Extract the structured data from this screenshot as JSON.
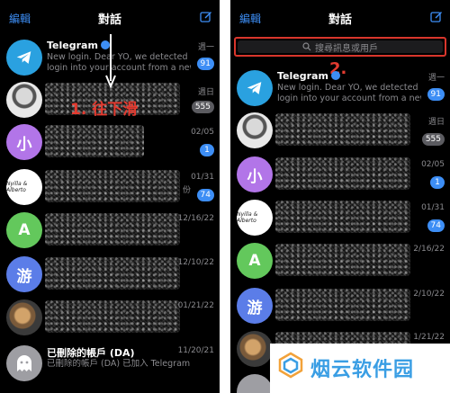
{
  "left": {
    "edit_label": "編輯",
    "title": "對話",
    "chats": [
      {
        "name": "Telegram",
        "preview": [
          "New login. Dear YO, we detected a",
          "login into your account from a new d"
        ],
        "date": "週一",
        "badge": "91"
      },
      {
        "name": "",
        "preview": [],
        "date": "週日",
        "badge": "555"
      },
      {
        "name": "",
        "preview": [],
        "date": "02/05",
        "badge": "1"
      },
      {
        "name": "",
        "preview": [
          "份"
        ],
        "date": "01/31",
        "badge": "74"
      },
      {
        "name": "",
        "preview": [],
        "date": "12/16/22",
        "badge": ""
      },
      {
        "name": "",
        "preview": [],
        "date": "12/10/22",
        "badge": ""
      },
      {
        "name": "",
        "preview": [],
        "date": "01/21/22",
        "badge": ""
      },
      {
        "name": "已刪除的帳戶 (DA)",
        "preview": [
          "已刪除的帳戶 (DA) 已加入 Telegram"
        ],
        "date": "11/20/21",
        "badge": ""
      }
    ],
    "avatars": {
      "chat3": "小",
      "chat5": "A",
      "chat6": "游",
      "chat4_script": "Nyilla & Alberto"
    },
    "annotation": "1. 往下滑"
  },
  "right": {
    "edit_label": "編輯",
    "title": "對話",
    "search_placeholder": "搜尋訊息或用戶",
    "annotation": "2.",
    "chats": [
      {
        "name": "Telegram",
        "preview": [
          "New login. Dear YO, we detected a",
          "login into your account from a new d"
        ],
        "date": "週一",
        "badge": "91"
      },
      {
        "name": "",
        "preview": [],
        "date": "週日",
        "badge": "555"
      },
      {
        "name": "",
        "preview": [],
        "date": "02/05",
        "badge": "1"
      },
      {
        "name": "",
        "preview": [],
        "date": "01/31",
        "badge": "74"
      },
      {
        "name": "",
        "preview": [],
        "date": "2/16/22",
        "badge": ""
      },
      {
        "name": "",
        "preview": [],
        "date": "2/10/22",
        "badge": ""
      },
      {
        "name": "",
        "preview": [],
        "date": "1/21/22",
        "badge": ""
      }
    ],
    "avatars": {
      "chat3": "小",
      "chat5": "A",
      "chat6": "游",
      "chat4_script": "Nyilla & Alberto"
    }
  },
  "watermark": "烟云软件园",
  "colors": {
    "accent": "#3d8ef5",
    "annotation": "#e43b30",
    "background": "#000000",
    "avatar_purple": "#b275e8",
    "avatar_green": "#63c85c",
    "avatar_blue": "#5b7de8",
    "watermark": "#3a9ee4"
  }
}
